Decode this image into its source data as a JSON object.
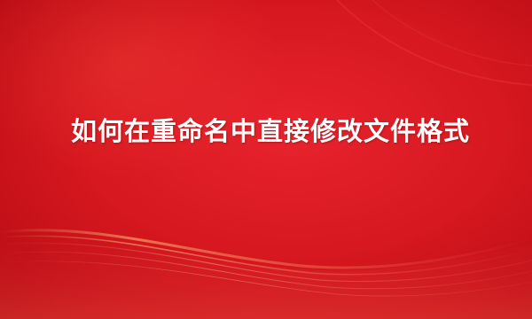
{
  "banner": {
    "title": "如何在重命名中直接修改文件格式",
    "colors": {
      "background": "#d71820",
      "title_text": "#ffffff",
      "wave_highlight": "#ffb37a"
    }
  }
}
